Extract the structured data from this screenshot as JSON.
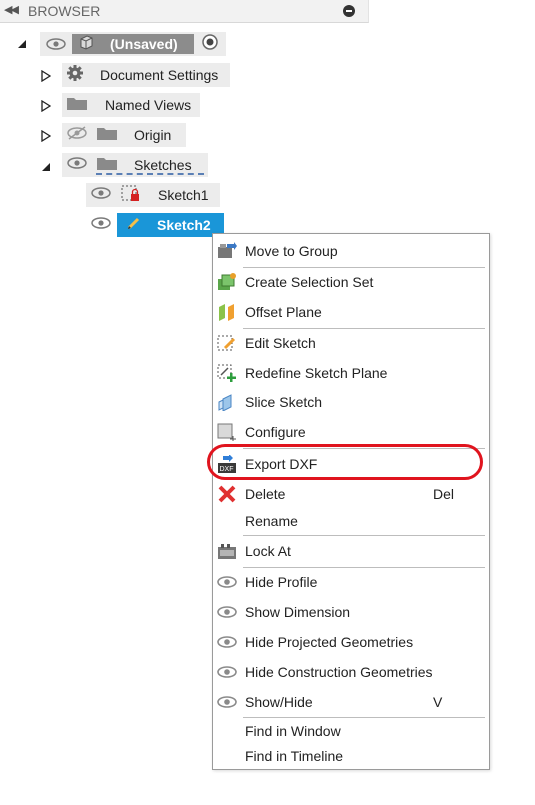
{
  "header": {
    "title": "BROWSER",
    "collapse_icon": "double-left-arrow",
    "menu_icon": "minus-circle"
  },
  "tree": {
    "root": {
      "label": "(Unsaved)"
    },
    "items": [
      {
        "label": "Document Settings",
        "icon": "gear-icon"
      },
      {
        "label": "Named Views",
        "icon": "folder-icon"
      },
      {
        "label": "Origin",
        "icon": "folder-icon"
      },
      {
        "label": "Sketches",
        "icon": "folder-icon"
      }
    ],
    "sketches": [
      {
        "label": "Sketch1"
      },
      {
        "label": "Sketch2",
        "selected": true
      }
    ]
  },
  "context_menu": {
    "items": [
      {
        "label": "Move to Group",
        "icon": "move-to-group-icon"
      },
      {
        "label": "Create Selection Set",
        "icon": "selection-set-icon"
      },
      {
        "label": "Offset Plane",
        "icon": "offset-plane-icon"
      },
      {
        "label": "Edit Sketch",
        "icon": "edit-sketch-icon"
      },
      {
        "label": "Redefine Sketch Plane",
        "icon": "redefine-plane-icon"
      },
      {
        "label": "Slice Sketch",
        "icon": "slice-sketch-icon"
      },
      {
        "label": "Configure",
        "icon": "configure-icon"
      },
      {
        "label": "Export DXF",
        "icon": "dxf-icon",
        "highlighted": true
      },
      {
        "label": "Delete",
        "icon": "delete-icon",
        "shortcut": "Del"
      },
      {
        "label": "Rename"
      },
      {
        "label": "Lock At",
        "icon": "lock-at-icon"
      },
      {
        "label": "Hide Profile",
        "icon": "eye-icon"
      },
      {
        "label": "Show Dimension",
        "icon": "eye-icon"
      },
      {
        "label": "Hide Projected Geometries",
        "icon": "eye-icon"
      },
      {
        "label": "Hide Construction Geometries",
        "icon": "eye-icon"
      },
      {
        "label": "Show/Hide",
        "icon": "eye-icon",
        "shortcut": "V"
      },
      {
        "label": "Find in Window"
      },
      {
        "label": "Find in Timeline"
      }
    ]
  },
  "colors": {
    "selected": "#1a96d8",
    "highlight_ring": "#e0141e",
    "chip": "#ececec"
  }
}
